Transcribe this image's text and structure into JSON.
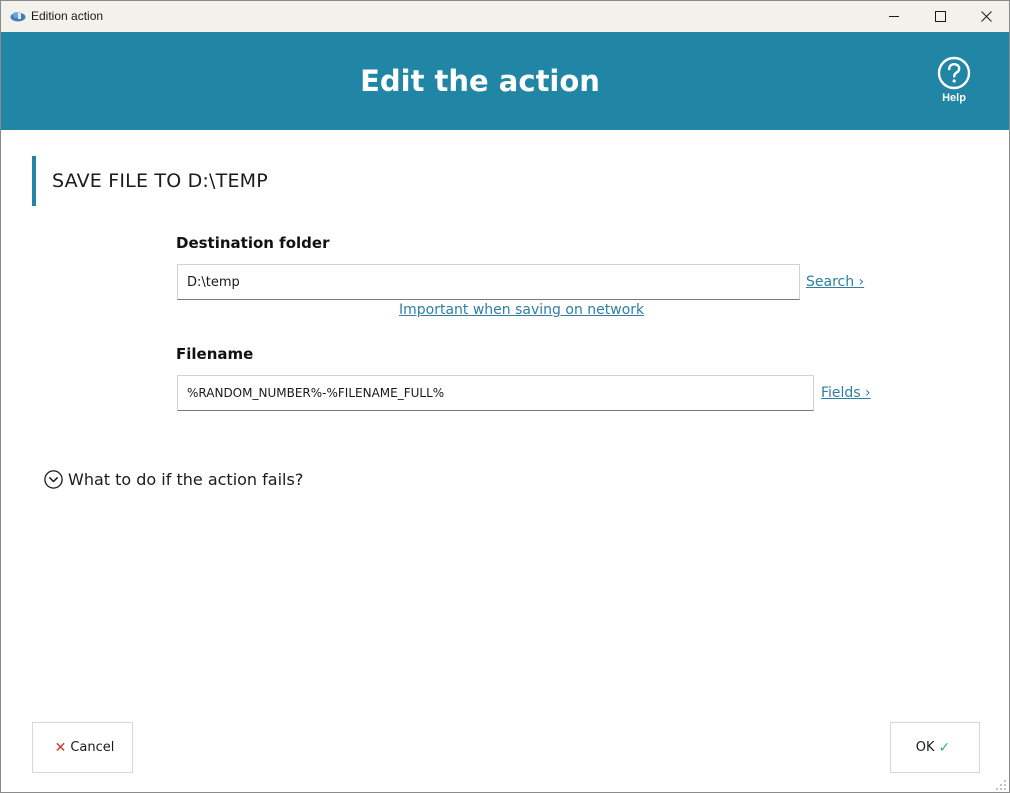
{
  "window": {
    "title": "Edition action",
    "controls": {
      "minimize": "minimize-icon",
      "maximize": "maximize-icon",
      "close": "close-icon"
    }
  },
  "header": {
    "title": "Edit the action",
    "help_label": "Help",
    "background": "#2185a5"
  },
  "section": {
    "title": "SAVE FILE TO D:\\TEMP"
  },
  "form": {
    "destination": {
      "label": "Destination folder",
      "value": "D:\\temp",
      "search_link": "Search ›",
      "network_link": "Important when saving on network"
    },
    "filename": {
      "label": "Filename",
      "value": "%RANDOM_NUMBER%-%FILENAME_FULL%",
      "fields_link": "Fields ›"
    }
  },
  "failure": {
    "label": "What to do if the action fails?"
  },
  "footer": {
    "cancel_label": "Cancel",
    "ok_label": "OK",
    "cancel_icon": "x-icon",
    "ok_icon": "check-icon"
  },
  "colors": {
    "accent": "#2185a5",
    "link": "#2d7fa3",
    "cancel_icon": "#d8322c",
    "ok_icon": "#2fb37a"
  }
}
